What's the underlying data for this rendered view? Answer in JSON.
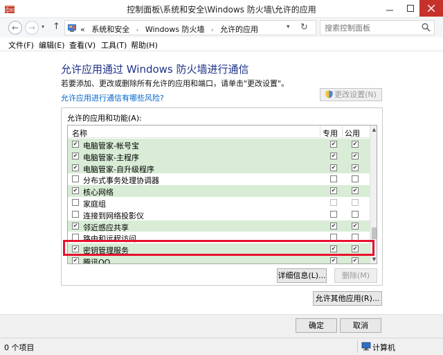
{
  "window": {
    "title": "控制面板\\系统和安全\\Windows 防火墙\\允许的应用",
    "min_icon": "minimize-icon",
    "max_icon": "maximize-icon",
    "close_icon": "close-icon"
  },
  "address": {
    "crumb_prefix": "«",
    "crumbs": [
      "系统和安全",
      "Windows 防火墙",
      "允许的应用"
    ],
    "separator": "›",
    "search_placeholder": "搜索控制面板"
  },
  "menu": [
    "文件(F)",
    "编辑(E)",
    "查看(V)",
    "工具(T)",
    "帮助(H)"
  ],
  "page": {
    "heading": "允许应用通过 Windows 防火墙进行通信",
    "description": "若要添加、更改或删除所有允许的应用和端口，请单击\"更改设置\"。",
    "risk_link": "允许应用进行通信有哪些风险?",
    "change_settings": "更改设置(N)",
    "group_label": "允许的应用和功能(A):",
    "columns": {
      "name": "名称",
      "private": "专用",
      "public": "公用"
    }
  },
  "apps": [
    {
      "name": "电脑管家-帐号宝",
      "enabled": true,
      "private": true,
      "public": true,
      "disabled": false
    },
    {
      "name": "电脑管家-主程序",
      "enabled": true,
      "private": true,
      "public": true,
      "disabled": false
    },
    {
      "name": "电脑管家-自升级程序",
      "enabled": true,
      "private": true,
      "public": true,
      "disabled": false
    },
    {
      "name": "分布式事务处理协调器",
      "enabled": false,
      "private": false,
      "public": false,
      "disabled": false
    },
    {
      "name": "核心网络",
      "enabled": true,
      "private": true,
      "public": true,
      "disabled": false
    },
    {
      "name": "家庭组",
      "enabled": false,
      "private": false,
      "public": false,
      "disabled": true
    },
    {
      "name": "连接到网络投影仪",
      "enabled": false,
      "private": false,
      "public": false,
      "disabled": false
    },
    {
      "name": "邻近感应共享",
      "enabled": true,
      "private": true,
      "public": true,
      "disabled": false
    },
    {
      "name": "路由和远程访问",
      "enabled": false,
      "private": false,
      "public": false,
      "disabled": false
    },
    {
      "name": "密钥管理服务",
      "enabled": true,
      "private": true,
      "public": true,
      "disabled": false
    },
    {
      "name": "腾讯QQ",
      "enabled": true,
      "private": true,
      "public": true,
      "disabled": false
    }
  ],
  "buttons": {
    "details": "详细信息(L)...",
    "remove": "删除(M)",
    "allow_other": "允许其他应用(R)...",
    "ok": "确定",
    "cancel": "取消"
  },
  "status": {
    "items": "0 个项目",
    "computer": "计算机"
  },
  "colors": {
    "heading": "#1e3287",
    "link": "#0066cc",
    "enabled_row": "#d8ecd6",
    "highlight": "#e8112c",
    "close_button": "#c7312b"
  },
  "checkmark": "✔",
  "icons": {
    "scroll_up": "▲",
    "scroll_down": "▼",
    "dropdown": "▾",
    "refresh": "↻",
    "back": "←",
    "forward": "→",
    "up": "↑"
  }
}
